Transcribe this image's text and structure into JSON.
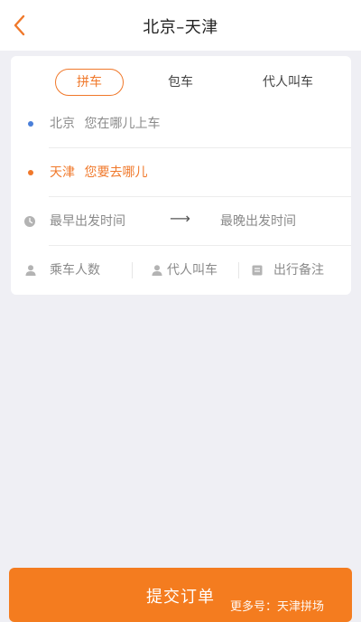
{
  "header": {
    "title": "北京–天津"
  },
  "tabs": [
    {
      "label": "拼车",
      "active": true
    },
    {
      "label": "包车",
      "active": false
    },
    {
      "label": "代人叫车",
      "active": false
    }
  ],
  "form": {
    "origin": {
      "city": "北京",
      "placeholder": "您在哪儿上车"
    },
    "destination": {
      "city": "天津",
      "placeholder": "您要去哪儿"
    },
    "time": {
      "earliest": "最早出发时间",
      "arrow": "⟶",
      "latest": "最晚出发时间"
    },
    "options": {
      "passengers": "乘车人数",
      "proxy": "代人叫车",
      "notes": "出行备注"
    }
  },
  "submit": {
    "label": "提交订单"
  },
  "watermark": {
    "text": "更多号：天津拼场"
  },
  "colors": {
    "accent": "#f0782a",
    "origin_dot": "#4a7fd9",
    "destination_dot": "#f0782a",
    "placeholder": "#8a8a8a"
  }
}
